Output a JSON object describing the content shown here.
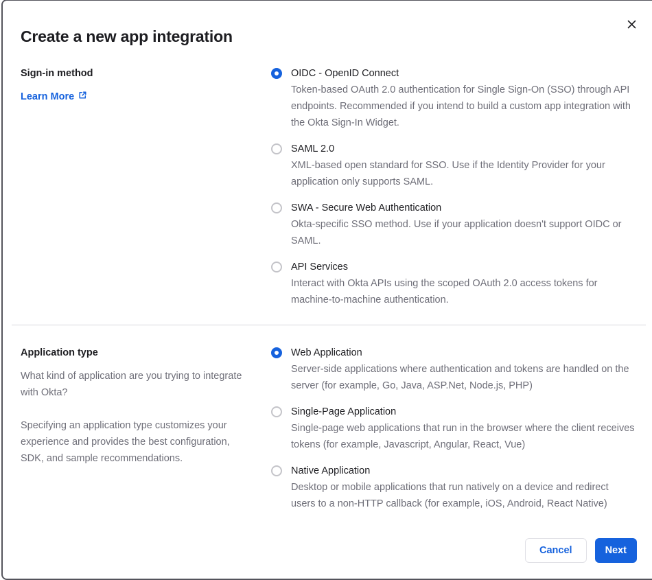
{
  "modal": {
    "title": "Create a new app integration"
  },
  "signin_section": {
    "label": "Sign-in method",
    "learn_more_label": "Learn More",
    "options": [
      {
        "label": "OIDC - OpenID Connect",
        "description": "Token-based OAuth 2.0 authentication for Single Sign-On (SSO) through API endpoints. Recommended if you intend to build a custom app integration with the Okta Sign-In Widget.",
        "selected": true
      },
      {
        "label": "SAML 2.0",
        "description": "XML-based open standard for SSO. Use if the Identity Provider for your application only supports SAML.",
        "selected": false
      },
      {
        "label": "SWA - Secure Web Authentication",
        "description": "Okta-specific SSO method. Use if your application doesn't support OIDC or SAML.",
        "selected": false
      },
      {
        "label": "API Services",
        "description": "Interact with Okta APIs using the scoped OAuth 2.0 access tokens for machine-to-machine authentication.",
        "selected": false
      }
    ]
  },
  "apptype_section": {
    "label": "Application type",
    "paragraph_1": "What kind of application are you trying to integrate with Okta?",
    "paragraph_2": "Specifying an application type customizes your experience and provides the best configuration, SDK, and sample recommendations.",
    "options": [
      {
        "label": "Web Application",
        "description": "Server-side applications where authentication and tokens are handled on the server (for example, Go, Java, ASP.Net, Node.js, PHP)",
        "selected": true
      },
      {
        "label": "Single-Page Application",
        "description": "Single-page web applications that run in the browser where the client receives tokens (for example, Javascript, Angular, React, Vue)",
        "selected": false
      },
      {
        "label": "Native Application",
        "description": "Desktop or mobile applications that run natively on a device and redirect users to a non-HTTP callback (for example, iOS, Android, React Native)",
        "selected": false
      }
    ]
  },
  "footer": {
    "cancel_label": "Cancel",
    "next_label": "Next"
  },
  "icons": {
    "close": "close-icon",
    "external_link": "external-link-icon"
  },
  "colors": {
    "accent_blue": "#1662dd",
    "text_dark": "#1d1d21",
    "text_gray": "#6e6e78",
    "divider": "#d7d7dc",
    "dialog_border": "#54545c",
    "radio_border": "#c4c4c9"
  }
}
